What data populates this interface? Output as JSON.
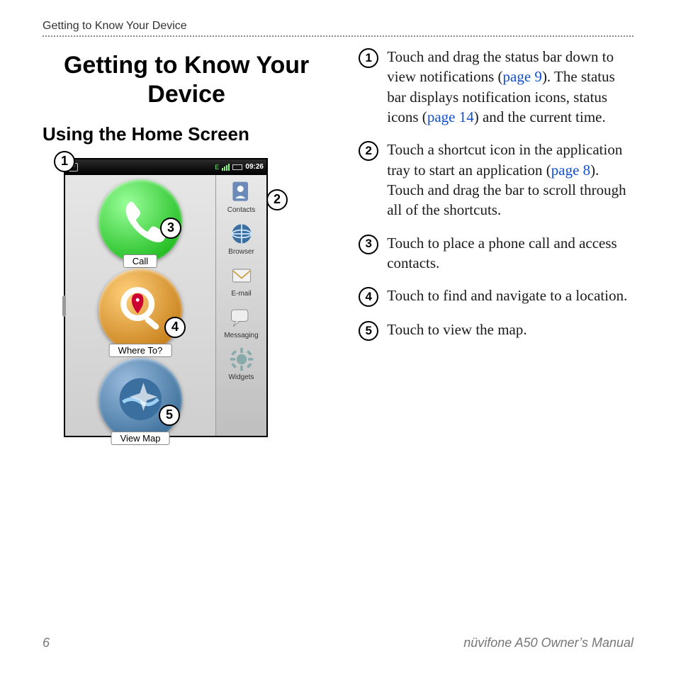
{
  "header": {
    "running_head": "Getting to Know Your Device"
  },
  "titles": {
    "h1": "Getting to Know Your Device",
    "h2": "Using the Home Screen"
  },
  "device": {
    "status": {
      "time": "09:26",
      "p_icon_label": "P"
    },
    "main_buttons": {
      "call": "Call",
      "where_to": "Where To?",
      "view_map": "View Map"
    },
    "tray_items": [
      "Contacts",
      "Browser",
      "E-mail",
      "Messaging",
      "Widgets"
    ]
  },
  "callouts": {
    "c1": "1",
    "c2": "2",
    "c3": "3",
    "c4": "4",
    "c5": "5"
  },
  "items": {
    "n1": "1",
    "t1a": "Touch and drag the status bar down to view notifications (",
    "t1ref1": "page 9",
    "t1b": "). The status bar displays notification icons, status icons (",
    "t1ref2": "page 14",
    "t1c": ") and the current time.",
    "n2": "2",
    "t2a": "Touch a shortcut icon in the application tray to start an application (",
    "t2ref": "page 8",
    "t2b": "). Touch and drag the bar to scroll through all of the shortcuts.",
    "n3": "3",
    "t3": "Touch to place a phone call and access contacts.",
    "n4": "4",
    "t4": "Touch to find and navigate to a location.",
    "n5": "5",
    "t5": "Touch to view the map."
  },
  "footer": {
    "page_number": "6",
    "book": "nüvifone A50 Owner’s Manual"
  }
}
